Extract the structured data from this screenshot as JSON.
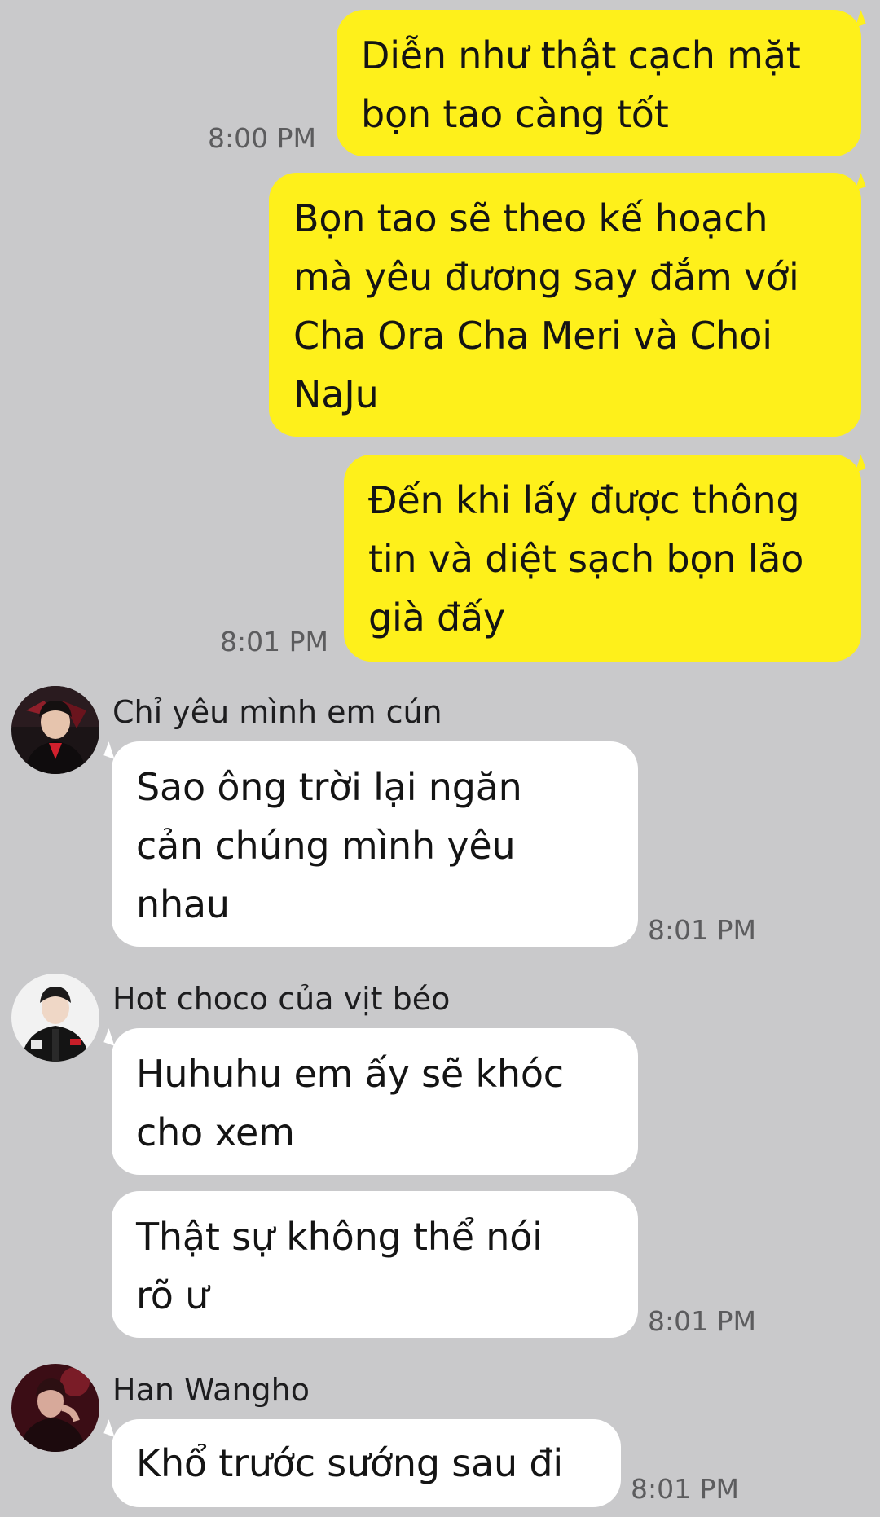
{
  "messages_out": [
    {
      "text": "Diễn như thật cạch mặt\nbọn tao càng tốt",
      "time": "8:00 PM"
    },
    {
      "text": "Bọn tao sẽ theo kế hoạch\nmà yêu đương say đắm với\nCha Ora Cha Meri và Choi\nNaJu",
      "time": ""
    },
    {
      "text": "Đến khi lấy được thông\ntin và diệt sạch bọn lão\ngià đấy",
      "time": "8:01 PM"
    }
  ],
  "groups_in": [
    {
      "sender": "Chỉ yêu mình em cún",
      "avatar_icon": "profile-photo-red-jacket",
      "messages": [
        {
          "text": "Sao ông trời lại ngăn\ncản chúng mình yêu\nnhau",
          "time": "8:01 PM"
        }
      ]
    },
    {
      "sender": "Hot choco của vịt béo",
      "avatar_icon": "profile-photo-black-jacket",
      "messages": [
        {
          "text": "Huhuhu em ấy sẽ khóc\ncho xem",
          "time": ""
        },
        {
          "text": "Thật sự không thể nói\nrõ ư",
          "time": "8:01 PM"
        }
      ]
    },
    {
      "sender": "Han Wangho",
      "avatar_icon": "profile-photo-stage-red",
      "messages": [
        {
          "text": "Khổ trước sướng sau đi",
          "time": "8:01 PM"
        }
      ]
    }
  ],
  "colors": {
    "background": "#c9c9cb",
    "outgoing_bubble": "#fef01b",
    "incoming_bubble": "#ffffff"
  }
}
